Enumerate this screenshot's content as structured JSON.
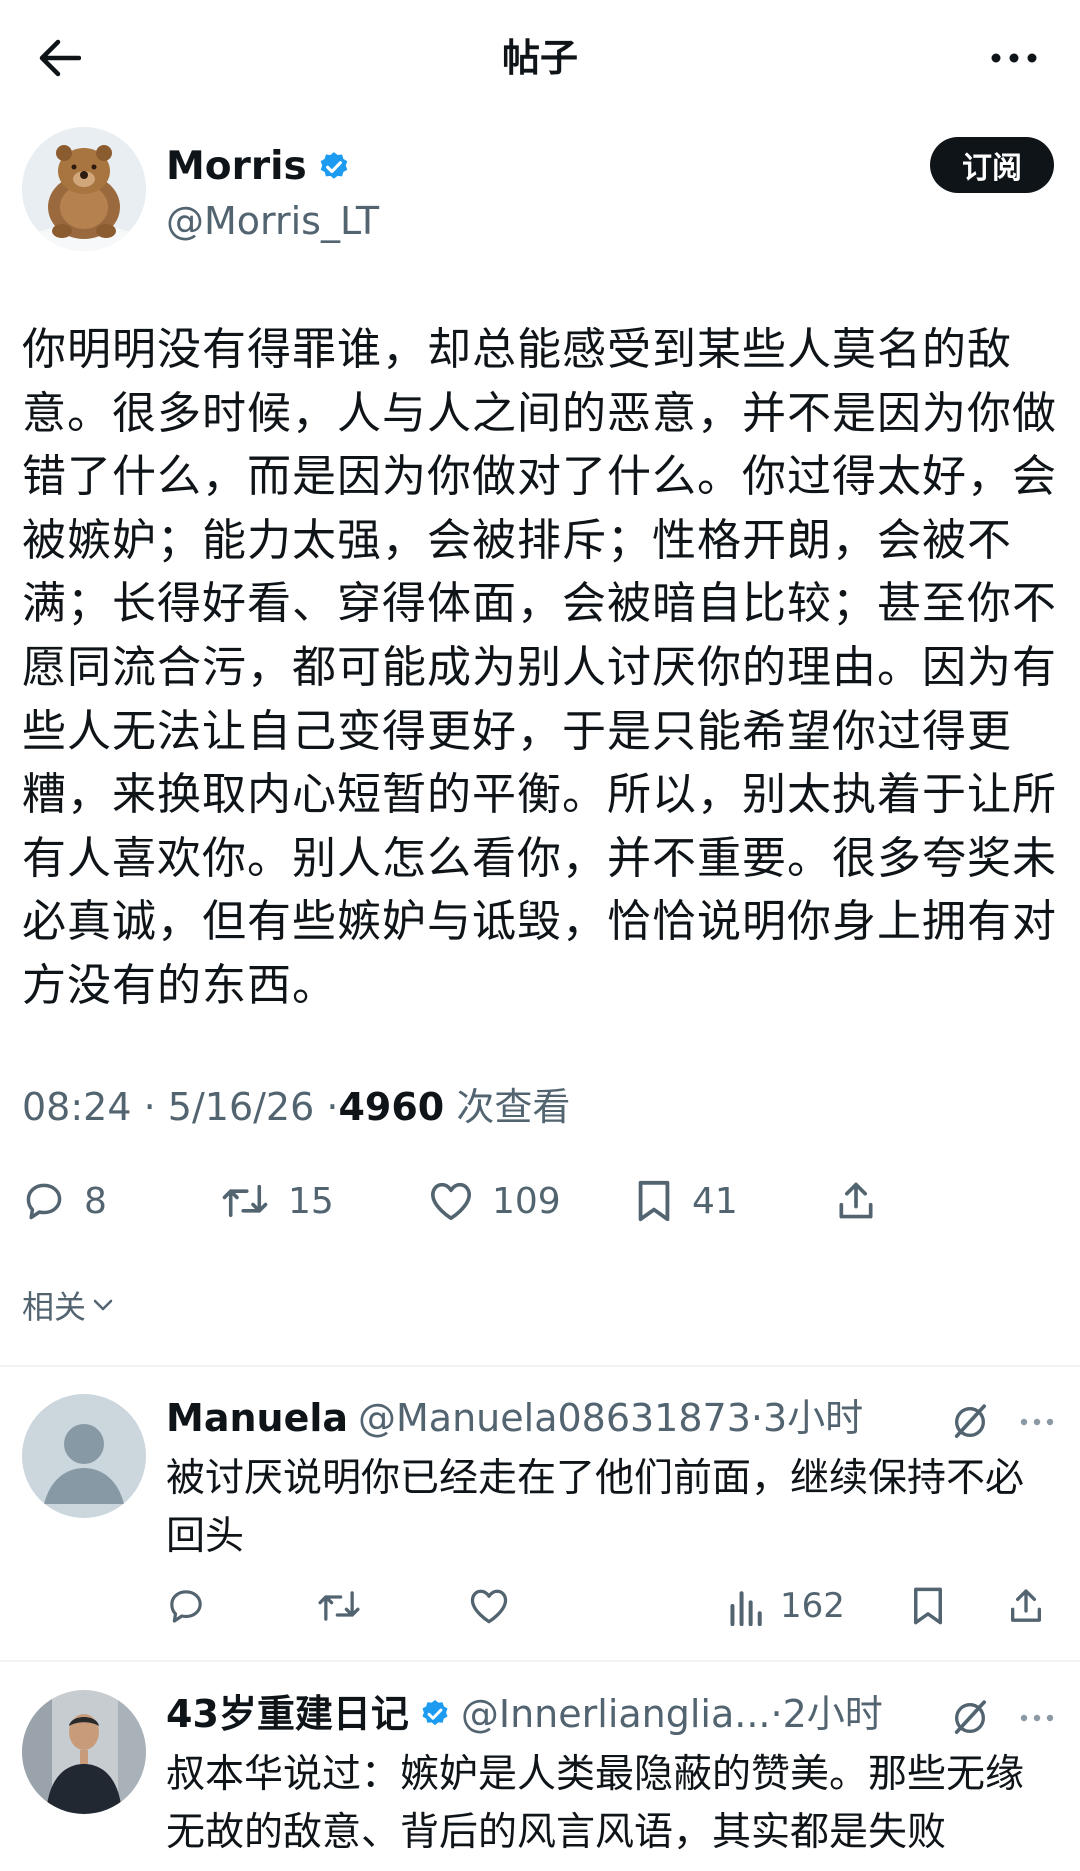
{
  "header": {
    "title": "帖子",
    "back_icon": "arrow-left-icon",
    "more_icon": "more-dots-icon"
  },
  "post": {
    "author": {
      "name": "Morris",
      "handle": "@Morris_LT",
      "verified": true,
      "verified_color": "#1d9bf0"
    },
    "subscribe_label": "订阅",
    "text": "你明明没有得罪谁，却总能感受到某些人莫名的敌意。很多时候，人与人之间的恶意，并不是因为你做错了什么，而是因为你做对了什么。你过得太好，会被嫉妒；能力太强，会被排斥；性格开朗，会被不满；长得好看、穿得体面，会被暗自比较；甚至你不愿同流合污，都可能成为别人讨厌你的理由。因为有些人无法让自己变得更好，于是只能希望你过得更糟，来换取内心短暂的平衡。所以，别太执着于让所有人喜欢你。别人怎么看你，并不重要。很多夸奖未必真诚，但有些嫉妒与诋毁，恰恰说明你身上拥有对方没有的东西。",
    "time": "08:24",
    "date": "5/16/26",
    "separator": "·",
    "views_count": "4960",
    "views_label": "次查看",
    "stats": {
      "replies": "8",
      "reposts": "15",
      "likes": "109",
      "bookmarks": "41"
    }
  },
  "related_label": "相关",
  "replies": [
    {
      "name": "Manuela",
      "handle": "@Manuela08631873",
      "separator": "·",
      "time": "3小时",
      "verified": false,
      "text": "被讨厌说明你已经走在了他们前面，继续保持不必回头",
      "views": "162"
    },
    {
      "name": "43岁重建日记",
      "handle": "@Innerlianglia...",
      "separator": "·",
      "time": "2小时",
      "verified": true,
      "text": "叔本华说过：嫉妒是人类最隐蔽的赞美。那些无缘无故的敌意、背后的风言风语，其实都是失败"
    }
  ],
  "colors": {
    "text": "#0f1419",
    "secondary": "#536471",
    "accent": "#1d9bf0",
    "divider": "#eff3f4"
  }
}
